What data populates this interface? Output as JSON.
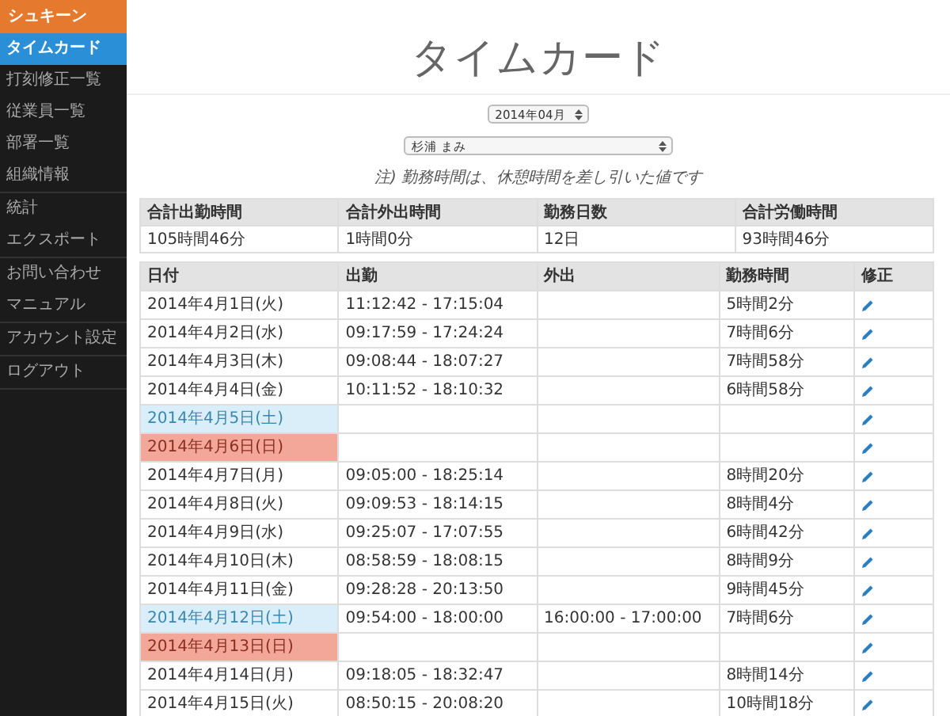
{
  "sidebar": {
    "brand": "シュキーン",
    "groups": [
      [
        {
          "label": "タイムカード",
          "selected": true
        },
        {
          "label": "打刻修正一覧",
          "selected": false
        },
        {
          "label": "従業員一覧",
          "selected": false
        },
        {
          "label": "部署一覧",
          "selected": false
        },
        {
          "label": "組織情報",
          "selected": false
        }
      ],
      [
        {
          "label": "統計",
          "selected": false
        },
        {
          "label": "エクスポート",
          "selected": false
        }
      ],
      [
        {
          "label": "お問い合わせ",
          "selected": false
        },
        {
          "label": "マニュアル",
          "selected": false
        }
      ],
      [
        {
          "label": "アカウント設定",
          "selected": false
        }
      ],
      [
        {
          "label": "ログアウト",
          "selected": false
        }
      ]
    ]
  },
  "title": "タイムカード",
  "month_select": {
    "value": "2014年04月"
  },
  "employee_select": {
    "value": "杉浦 まみ"
  },
  "note": "注) 勤務時間は、休憩時間を差し引いた値です",
  "summary": {
    "columns": [
      "合計出勤時間",
      "合計外出時間",
      "勤務日数",
      "合計労働時間"
    ],
    "values": [
      "105時間46分",
      "1時間0分",
      "12日",
      "93時間46分"
    ]
  },
  "table": {
    "columns": [
      "日付",
      "出勤",
      "外出",
      "勤務時間",
      "修正"
    ],
    "rows": [
      {
        "kind": "weekday",
        "date": "2014年4月1日(火)",
        "attendance": "11:12:42 - 17:15:04",
        "outing": "",
        "hours": "5時間2分"
      },
      {
        "kind": "weekday",
        "date": "2014年4月2日(水)",
        "attendance": "09:17:59 - 17:24:24",
        "outing": "",
        "hours": "7時間6分"
      },
      {
        "kind": "weekday",
        "date": "2014年4月3日(木)",
        "attendance": "09:08:44 - 18:07:27",
        "outing": "",
        "hours": "7時間58分"
      },
      {
        "kind": "weekday",
        "date": "2014年4月4日(金)",
        "attendance": "10:11:52 - 18:10:32",
        "outing": "",
        "hours": "6時間58分"
      },
      {
        "kind": "saturday",
        "date": "2014年4月5日(土)",
        "attendance": "",
        "outing": "",
        "hours": ""
      },
      {
        "kind": "sunday",
        "date": "2014年4月6日(日)",
        "attendance": "",
        "outing": "",
        "hours": ""
      },
      {
        "kind": "weekday",
        "date": "2014年4月7日(月)",
        "attendance": "09:05:00 - 18:25:14",
        "outing": "",
        "hours": "8時間20分"
      },
      {
        "kind": "weekday",
        "date": "2014年4月8日(火)",
        "attendance": "09:09:53 - 18:14:15",
        "outing": "",
        "hours": "8時間4分"
      },
      {
        "kind": "weekday",
        "date": "2014年4月9日(水)",
        "attendance": "09:25:07 - 17:07:55",
        "outing": "",
        "hours": "6時間42分"
      },
      {
        "kind": "weekday",
        "date": "2014年4月10日(木)",
        "attendance": "08:58:59 - 18:08:15",
        "outing": "",
        "hours": "8時間9分"
      },
      {
        "kind": "weekday",
        "date": "2014年4月11日(金)",
        "attendance": "09:28:28 - 20:13:50",
        "outing": "",
        "hours": "9時間45分"
      },
      {
        "kind": "saturday",
        "date": "2014年4月12日(土)",
        "attendance": "09:54:00 - 18:00:00",
        "outing": "16:00:00 - 17:00:00",
        "hours": "7時間6分"
      },
      {
        "kind": "sunday",
        "date": "2014年4月13日(日)",
        "attendance": "",
        "outing": "",
        "hours": ""
      },
      {
        "kind": "weekday",
        "date": "2014年4月14日(月)",
        "attendance": "09:18:05 - 18:32:47",
        "outing": "",
        "hours": "8時間14分"
      },
      {
        "kind": "weekday",
        "date": "2014年4月15日(火)",
        "attendance": "08:50:15 - 20:08:20",
        "outing": "",
        "hours": "10時間18分"
      }
    ]
  }
}
